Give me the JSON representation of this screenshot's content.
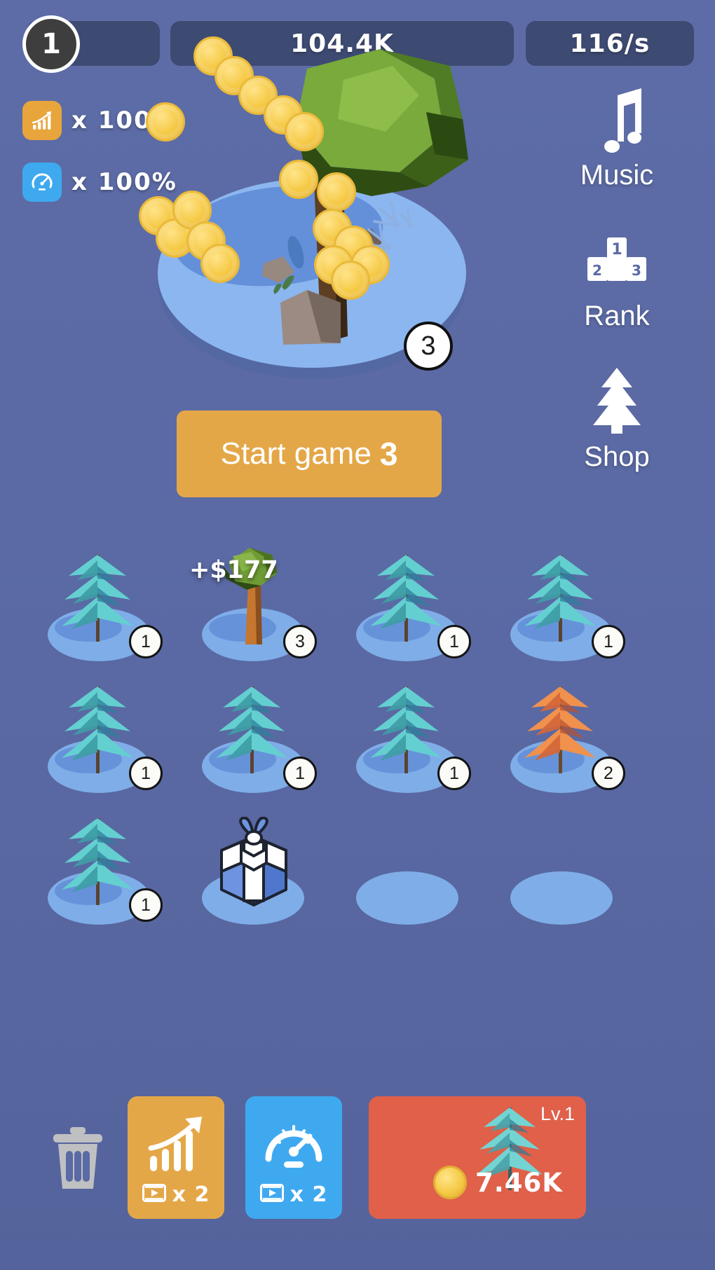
{
  "hud": {
    "level_badge": "1",
    "coins": "104.4K",
    "rate": "116/s",
    "multipliers": [
      {
        "icon": "growth-chart-icon",
        "label": "x 100%",
        "color": "#e8a53c"
      },
      {
        "icon": "speedometer-icon",
        "label": "x 100%",
        "color": "#3ea9ee"
      }
    ]
  },
  "right_menu": [
    {
      "icon": "music-note-icon",
      "label": "Music"
    },
    {
      "icon": "podium-rank-icon",
      "label": "Rank"
    },
    {
      "icon": "pine-tree-icon",
      "label": "Shop"
    }
  ],
  "main_island": {
    "badge": "3"
  },
  "start_button": {
    "label": "Start game",
    "count": "3"
  },
  "grid": {
    "rows": [
      [
        {
          "type": "tree",
          "variant": "pine-teal",
          "badge": "1",
          "popup": ""
        },
        {
          "type": "tree",
          "variant": "leafy-green",
          "badge": "3",
          "popup": "+$177"
        },
        {
          "type": "tree",
          "variant": "pine-teal",
          "badge": "1",
          "popup": ""
        },
        {
          "type": "tree",
          "variant": "pine-teal",
          "badge": "1",
          "popup": ""
        }
      ],
      [
        {
          "type": "tree",
          "variant": "pine-teal",
          "badge": "1",
          "popup": ""
        },
        {
          "type": "tree",
          "variant": "pine-teal",
          "badge": "1",
          "popup": ""
        },
        {
          "type": "tree",
          "variant": "pine-teal",
          "badge": "1",
          "popup": ""
        },
        {
          "type": "tree",
          "variant": "pine-orange",
          "badge": "2",
          "popup": ""
        }
      ],
      [
        {
          "type": "tree",
          "variant": "pine-teal",
          "badge": "1",
          "popup": ""
        },
        {
          "type": "gift",
          "variant": "gift-box",
          "badge": "",
          "popup": ""
        },
        {
          "type": "empty",
          "variant": "",
          "badge": "",
          "popup": ""
        },
        {
          "type": "empty",
          "variant": "",
          "badge": "",
          "popup": ""
        }
      ]
    ]
  },
  "bottom_bar": {
    "trash_icon": "trash-can-icon",
    "boosts": [
      {
        "icon": "growth-chart-icon",
        "video_icon": "video-ad-icon",
        "multiplier": "x 2",
        "color": "#e4a748"
      },
      {
        "icon": "speedometer-icon",
        "video_icon": "video-ad-icon",
        "multiplier": "x 2",
        "color": "#3fa9f0"
      }
    ],
    "buy_card": {
      "level": "Lv.1",
      "price": "7.46K",
      "tree_icon": "pine-tree-teal-icon",
      "color": "#e0604a"
    }
  }
}
